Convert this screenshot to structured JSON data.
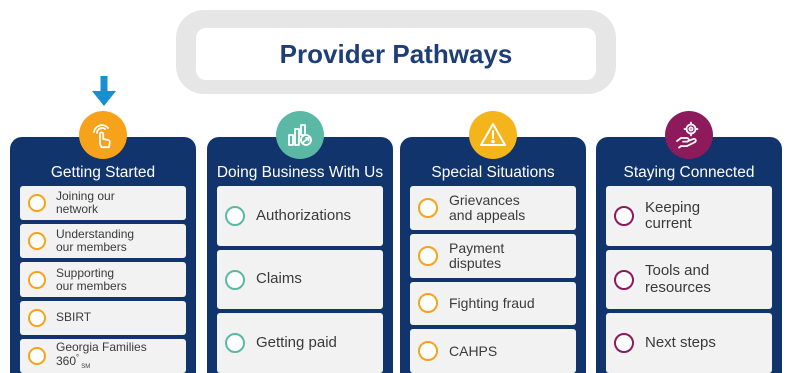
{
  "header": {
    "title": "Provider Pathways"
  },
  "colors": {
    "navy": "#10346b",
    "orange": "#f7a21b",
    "teal": "#5bb8a4",
    "yellow": "#f3b41c",
    "purple": "#8d1a5a",
    "arrow": "#1790d3"
  },
  "columns": [
    {
      "title": "Getting Started",
      "icon": "touch-hand-icon",
      "items": [
        {
          "label": "Joining our\nnetwork"
        },
        {
          "label": "Understanding\nour members"
        },
        {
          "label": "Supporting\nour members"
        },
        {
          "label": "SBIRT"
        },
        {
          "label": "Georgia Families\n360"
        }
      ],
      "sup": "°",
      "sub": "SM"
    },
    {
      "title": "Doing Business With Us",
      "icon": "chart-growth-icon",
      "items": [
        {
          "label": "Authorizations"
        },
        {
          "label": "Claims"
        },
        {
          "label": "Getting paid"
        }
      ]
    },
    {
      "title": "Special Situations",
      "icon": "warning-icon",
      "items": [
        {
          "label": "Grievances\nand appeals"
        },
        {
          "label": "Payment\ndisputes"
        },
        {
          "label": "Fighting fraud"
        },
        {
          "label": "CAHPS"
        }
      ]
    },
    {
      "title": "Staying Connected",
      "icon": "hand-gear-icon",
      "items": [
        {
          "label": "Keeping\ncurrent"
        },
        {
          "label": "Tools and\nresources"
        },
        {
          "label": "Next steps"
        }
      ]
    }
  ]
}
